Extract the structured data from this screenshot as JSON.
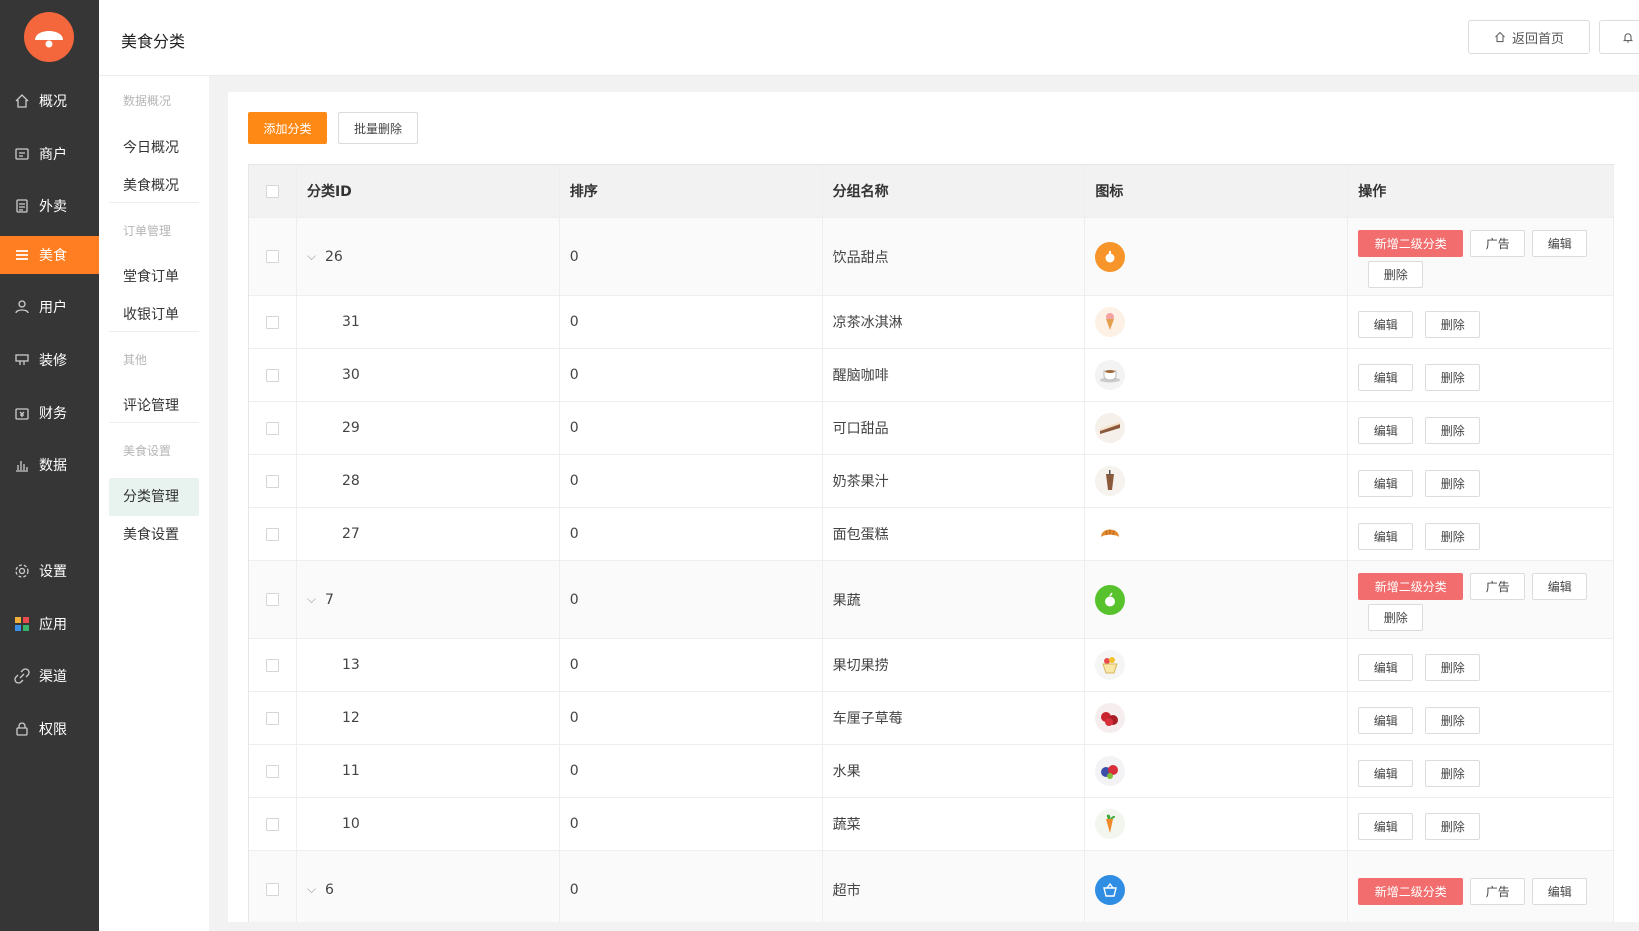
{
  "app": {
    "page_title": "美食分类"
  },
  "sidebar": {
    "items": [
      {
        "label": "概况",
        "icon": "home-icon"
      },
      {
        "label": "商户",
        "icon": "store-icon"
      },
      {
        "label": "外卖",
        "icon": "document-icon"
      },
      {
        "label": "美食",
        "icon": "menu-icon",
        "active": true
      },
      {
        "label": "用户",
        "icon": "user-icon"
      },
      {
        "label": "装修",
        "icon": "brush-icon"
      },
      {
        "label": "财务",
        "icon": "wallet-icon"
      },
      {
        "label": "数据",
        "icon": "bar-chart-icon"
      },
      {
        "label": "设置",
        "icon": "gear-icon"
      },
      {
        "label": "应用",
        "icon": "apps-icon"
      },
      {
        "label": "渠道",
        "icon": "link-icon"
      },
      {
        "label": "权限",
        "icon": "lock-icon"
      }
    ]
  },
  "subnav": {
    "groups": [
      {
        "title": "数据概况",
        "items": [
          "今日概况",
          "美食概况"
        ]
      },
      {
        "title": "订单管理",
        "items": [
          "堂食订单",
          "收银订单"
        ]
      },
      {
        "title": "其他",
        "items": [
          "评论管理"
        ]
      },
      {
        "title": "美食设置",
        "items": [
          "分类管理",
          "美食设置"
        ]
      }
    ],
    "active": "分类管理"
  },
  "header": {
    "home_label": "返回首页"
  },
  "toolbar": {
    "add_label": "添加分类",
    "batch_delete_label": "批量删除"
  },
  "table": {
    "columns": [
      "分类ID",
      "排序",
      "分组名称",
      "图标",
      "操作"
    ],
    "actions": {
      "add_sub": "新增二级分类",
      "ad": "广告",
      "edit": "编辑",
      "delete": "删除"
    },
    "rows": [
      {
        "id": "26",
        "sort": "0",
        "name": "饮品甜点",
        "level": 1,
        "icon": "dessert-icon"
      },
      {
        "id": "31",
        "sort": "0",
        "name": "凉茶冰淇淋",
        "level": 2,
        "icon": "ice-cream-icon"
      },
      {
        "id": "30",
        "sort": "0",
        "name": "醒脑咖啡",
        "level": 2,
        "icon": "coffee-icon"
      },
      {
        "id": "29",
        "sort": "0",
        "name": "可口甜品",
        "level": 2,
        "icon": "cake-slice-icon"
      },
      {
        "id": "28",
        "sort": "0",
        "name": "奶茶果汁",
        "level": 2,
        "icon": "milk-tea-icon"
      },
      {
        "id": "27",
        "sort": "0",
        "name": "面包蛋糕",
        "level": 2,
        "icon": "croissant-icon"
      },
      {
        "id": "7",
        "sort": "0",
        "name": "果蔬",
        "level": 1,
        "icon": "apple-icon"
      },
      {
        "id": "13",
        "sort": "0",
        "name": "果切果捞",
        "level": 2,
        "icon": "fruit-cup-icon"
      },
      {
        "id": "12",
        "sort": "0",
        "name": "车厘子草莓",
        "level": 2,
        "icon": "cherry-icon"
      },
      {
        "id": "11",
        "sort": "0",
        "name": "水果",
        "level": 2,
        "icon": "fruit-icon"
      },
      {
        "id": "10",
        "sort": "0",
        "name": "蔬菜",
        "level": 2,
        "icon": "vegetable-icon"
      },
      {
        "id": "6",
        "sort": "0",
        "name": "超市",
        "level": 1,
        "icon": "basket-icon"
      }
    ]
  },
  "colors": {
    "accent": "#ff7e21",
    "danger": "#f26d6d",
    "sidebar": "#363636"
  }
}
